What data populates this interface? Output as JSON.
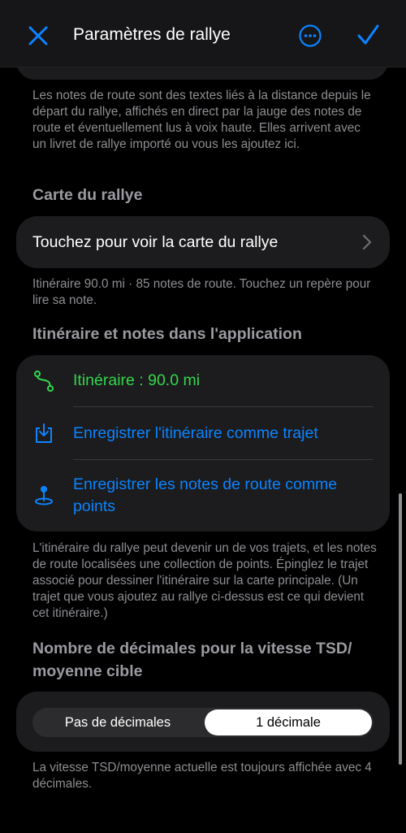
{
  "nav": {
    "title": "Paramètres de rallye",
    "close_icon": "close-x-icon",
    "more_icon": "ellipsis-circle-icon",
    "done_icon": "checkmark-icon",
    "accent": "#0a84ff"
  },
  "notes_footer": "Les notes de route sont des textes liés à la distance depuis le départ du rallye, affichés en direct par la jauge des notes de route et éventuellement lus à voix haute. Elles arrivent avec un livret de rallye importé ou vous les ajoutez ici.",
  "map_section": {
    "header": "Carte du rallye",
    "row_label": "Touchez pour voir la carte du rallye",
    "footer": "Itinéraire 90.0 mi · 85 notes de route. Touchez un repère pour lire sa note."
  },
  "route_section": {
    "header": "Itinéraire et notes dans l'application",
    "rows": [
      {
        "label": "Itinéraire : 90.0 mi",
        "icon": "route-path-icon",
        "color": "#32d74b"
      },
      {
        "label": "Enregistrer l'itinéraire comme trajet",
        "icon": "download-tray-icon",
        "color": "#0a84ff"
      },
      {
        "label": "Enregistrer les notes de route comme points",
        "icon": "map-pin-icon",
        "color": "#0a84ff"
      }
    ],
    "footer": "L'itinéraire du rallye peut devenir un de vos trajets, et les notes de route localisées une collection de points. Épinglez le trajet associé pour dessiner l'itinéraire sur la carte principale. (Un trajet que vous ajoutez au rallye ci-dessus est ce qui devient cet itinéraire.)"
  },
  "decimals_section": {
    "header": "Nombre de décimales pour la vitesse TSD/ moyenne cible",
    "options": [
      "Pas de décimales",
      "1 décimale"
    ],
    "selected": "1 décimale",
    "footer": "La vitesse TSD/moyenne actuelle est toujours affichée avec 4 décimales."
  }
}
